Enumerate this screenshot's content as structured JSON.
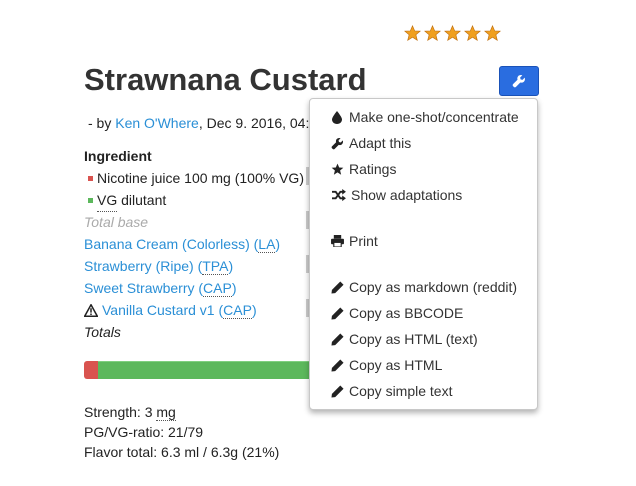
{
  "rating": {
    "stars": 5,
    "max": 5,
    "star_color": "#f0a020"
  },
  "title": "Strawnana Custard",
  "byline": {
    "prefix": "- by ",
    "author": "Ken O'Where",
    "suffix": ", Dec 9. 2016, 04:"
  },
  "table": {
    "header": "Ingredient",
    "nicotine": {
      "label": "Nicotine juice 100 mg (100% VG)",
      "color": "#d9534f"
    },
    "vg": {
      "abbr": "VG",
      "rest": " dilutant",
      "color": "#5cb85c"
    },
    "total_base": "Total base",
    "flavors": [
      {
        "name": "Banana Cream (Colorless) (",
        "abbr": "LA",
        "close": ")",
        "warning": false
      },
      {
        "name": "Strawberry (Ripe) (",
        "abbr": "TPA",
        "close": ")",
        "warning": false
      },
      {
        "name": "Sweet Strawberry (",
        "abbr": "CAP",
        "close": ")",
        "warning": false
      },
      {
        "name": "Vanilla Custard v1 (",
        "abbr": "CAP",
        "close": ")",
        "warning": true
      }
    ],
    "totals": "Totals"
  },
  "stats": {
    "strength_label": "Strength: 3 ",
    "strength_unit": "mg",
    "ratio": "PG/VG-ratio: 21/79",
    "flavor_total": "Flavor total: 6.3 ml / 6.3g (21%)"
  },
  "menu": {
    "items": [
      {
        "label": "Make one-shot/concentrate",
        "icon": "tint-icon"
      },
      {
        "label": "Adapt this",
        "icon": "wrench-icon"
      },
      {
        "label": "Ratings",
        "icon": "star-icon"
      },
      {
        "label": "Show adaptations",
        "icon": "shuffle-icon"
      },
      {
        "label": "Print",
        "icon": "print-icon"
      },
      {
        "label": "Copy as markdown (reddit)",
        "icon": "pencil-icon"
      },
      {
        "label": "Copy as BBCODE",
        "icon": "pencil-icon"
      },
      {
        "label": "Copy as HTML (text)",
        "icon": "pencil-icon"
      },
      {
        "label": "Copy as HTML",
        "icon": "pencil-icon"
      },
      {
        "label": "Copy simple text",
        "icon": "pencil-icon"
      }
    ]
  },
  "colors": {
    "accent": "#2a6de0",
    "link": "#2a8fd6"
  }
}
